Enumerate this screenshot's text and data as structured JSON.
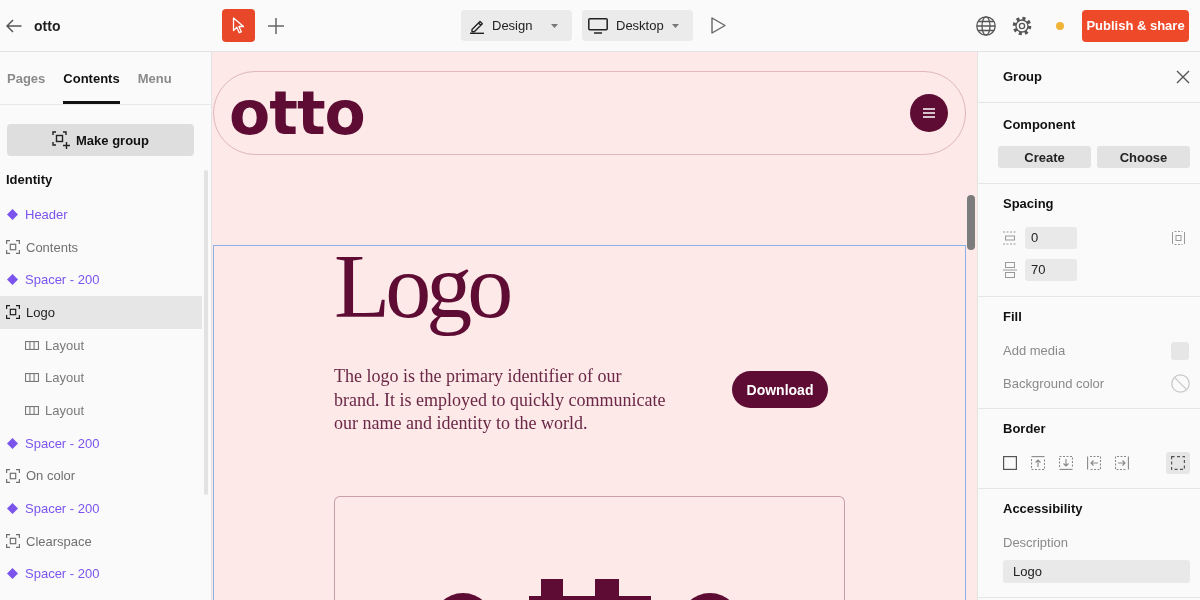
{
  "topbar": {
    "title": "otto",
    "tools": [
      {
        "kind": "select",
        "selected": true
      },
      {
        "kind": "add",
        "selected": false
      }
    ],
    "mode": "Design",
    "device": "Desktop",
    "unsaved": true,
    "publish": "Publish & share"
  },
  "sidebar": {
    "tabs": [
      {
        "label": "Pages",
        "selected": false
      },
      {
        "label": "Contents",
        "selected": true
      },
      {
        "label": "Menu",
        "selected": false
      }
    ],
    "make_group": "Make group",
    "section": "Identity",
    "items": [
      {
        "label": "Header",
        "kind": "component",
        "selected": false
      },
      {
        "label": "Contents",
        "kind": "group",
        "selected": false
      },
      {
        "label": "Spacer - 200",
        "kind": "component",
        "selected": false
      },
      {
        "label": "Logo",
        "kind": "group",
        "selected": true,
        "children": [
          {
            "label": "Layout",
            "kind": "layout",
            "selected": false
          },
          {
            "label": "Layout",
            "kind": "layout",
            "selected": false
          },
          {
            "label": "Layout",
            "kind": "layout",
            "selected": false
          }
        ]
      },
      {
        "label": "Spacer - 200",
        "kind": "component",
        "selected": false
      },
      {
        "label": "On color",
        "kind": "group",
        "selected": false
      },
      {
        "label": "Spacer - 200",
        "kind": "component",
        "selected": false
      },
      {
        "label": "Clearspace",
        "kind": "group",
        "selected": false
      },
      {
        "label": "Spacer - 200",
        "kind": "component",
        "selected": false
      }
    ]
  },
  "canvas": {
    "site_header": {
      "logo": "otto"
    },
    "section": {
      "selected": true,
      "title": "Logo",
      "body": "The logo is the primary identifier of our\nbrand. It is employed to quickly communicate\nour name and identity to the world.",
      "button": "Download"
    }
  },
  "inspector": {
    "title": "Group",
    "component": {
      "heading": "Component",
      "buttons": [
        "Create",
        "Choose"
      ]
    },
    "spacing": {
      "heading": "Spacing",
      "fields": [
        {
          "kind": "padding",
          "value": "0"
        },
        {
          "kind": "gap",
          "value": "70"
        }
      ]
    },
    "fill": {
      "heading": "Fill",
      "rows": [
        {
          "kind": "media",
          "label": "Add media"
        },
        {
          "kind": "color",
          "label": "Background color"
        }
      ]
    },
    "border": {
      "heading": "Border",
      "options": [
        {
          "kind": "all",
          "selected": false
        },
        {
          "kind": "top",
          "selected": false
        },
        {
          "kind": "bottom",
          "selected": false
        },
        {
          "kind": "left",
          "selected": false
        },
        {
          "kind": "right",
          "selected": false
        },
        {
          "kind": "none",
          "selected": true
        }
      ]
    },
    "accessibility": {
      "heading": "Accessibility",
      "label": "Description",
      "value": "Logo"
    }
  }
}
